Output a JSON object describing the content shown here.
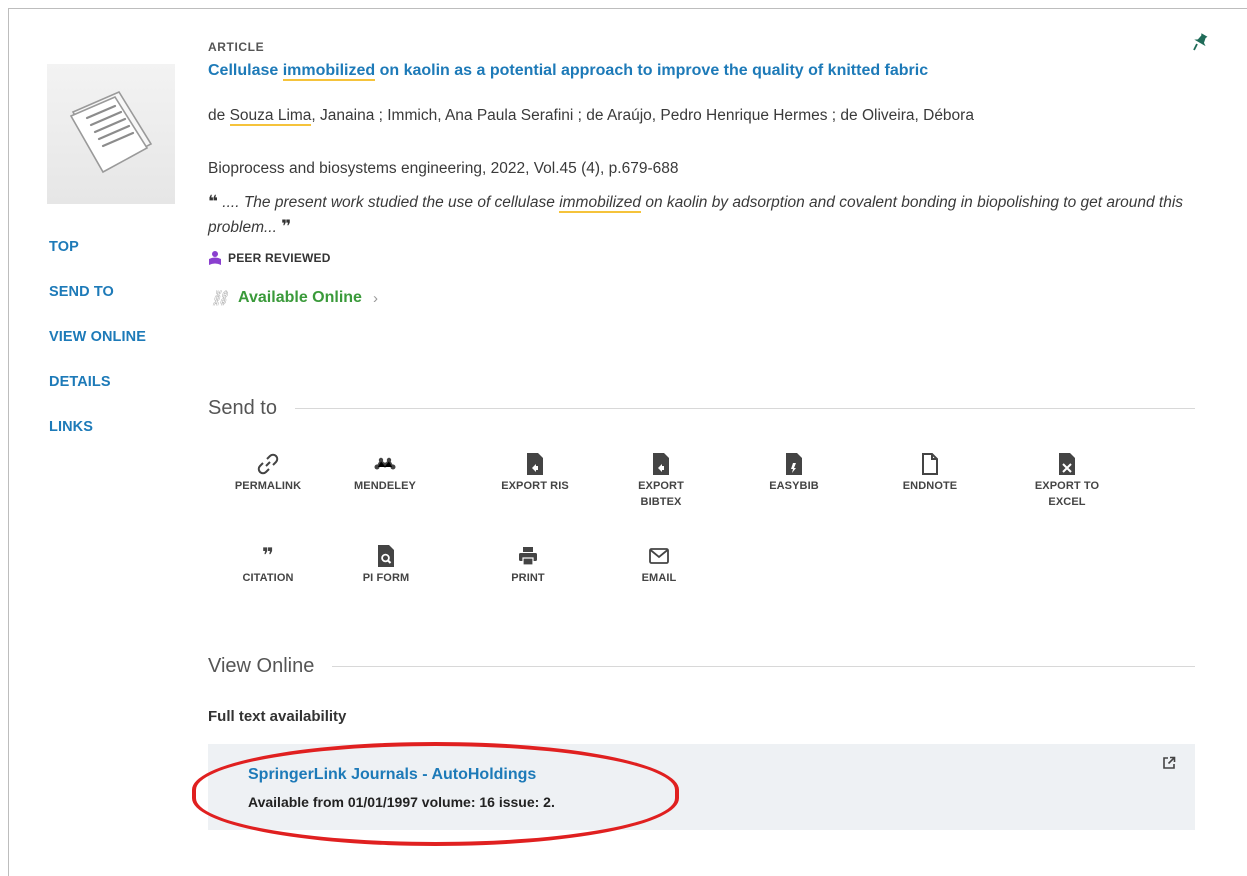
{
  "nav": {
    "items": [
      "TOP",
      "SEND TO",
      "VIEW ONLINE",
      "DETAILS",
      "LINKS"
    ]
  },
  "record": {
    "type": "ARTICLE",
    "title_parts": [
      "Cellulase ",
      "immobilized",
      " on kaolin as a potential approach to improve the quality of knitted fabric"
    ],
    "authors_pre": "de ",
    "authors_hl": "Souza Lima",
    "authors_post": ", Janaina ; Immich, Ana Paula Serafini ; de Araújo, Pedro Henrique Hermes ; de Oliveira, Débora",
    "source": "Bioprocess and biosystems engineering, 2022, Vol.45 (4), p.679-688",
    "snippet_pre": ".... The present work studied the use of cellulase ",
    "snippet_hl": "immobilized",
    "snippet_post": " on kaolin by adsorption and covalent bonding in biopolishing to get around this problem...",
    "peer_reviewed": "PEER REVIEWED",
    "availability": "Available Online"
  },
  "send_to": {
    "heading": "Send to",
    "actions": [
      {
        "label": "PERMALINK",
        "icon": "link-icon"
      },
      {
        "label": "MENDELEY",
        "icon": "mendeley-icon"
      },
      {
        "label": "EXPORT RIS",
        "icon": "file-export-icon"
      },
      {
        "label": "EXPORT BIBTEX",
        "icon": "file-export-icon"
      },
      {
        "label": "EASYBIB",
        "icon": "file-export-icon"
      },
      {
        "label": "ENDNOTE",
        "icon": "file-outline-icon"
      },
      {
        "label": "EXPORT TO EXCEL",
        "icon": "excel-file-icon"
      },
      {
        "label": "CITATION",
        "icon": "quote-icon"
      },
      {
        "label": "PI FORM",
        "icon": "file-search-icon"
      },
      {
        "label": "PRINT",
        "icon": "printer-icon"
      },
      {
        "label": "EMAIL",
        "icon": "envelope-icon"
      }
    ]
  },
  "view_online": {
    "heading": "View Online",
    "subheading": "Full text availability",
    "service_name": "SpringerLink Journals - AutoHoldings",
    "service_availability": "Available from 01/01/1997 volume: 16 issue: 2."
  },
  "colors": {
    "link": "#1d7ab8",
    "available": "#3a9a3a",
    "highlight": "#f5c33b",
    "annotation": "#e02020",
    "service_bg": "#eef1f4"
  }
}
